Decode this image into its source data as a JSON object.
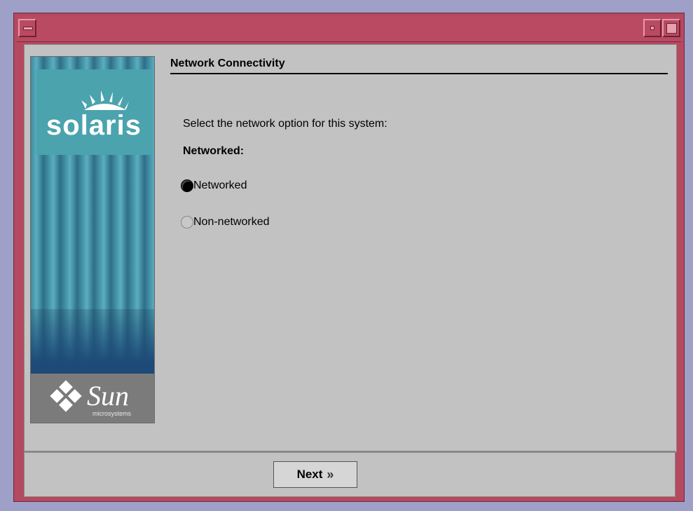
{
  "window": {
    "title": ""
  },
  "banner": {
    "product": "solaris",
    "vendor": "Sun",
    "vendor_sub": "microsystems"
  },
  "page": {
    "heading": "Network Connectivity",
    "prompt": "Select the network option for this system:",
    "group_label": "Networked:",
    "options": [
      {
        "label": "Networked",
        "selected": true
      },
      {
        "label": "Non-networked",
        "selected": false
      }
    ]
  },
  "footer": {
    "next_label": "Next"
  },
  "icons": {
    "window_menu": "window-menu-icon",
    "minimize": "minimize-icon",
    "maximize": "maximize-icon",
    "next": "chevron-right-icon"
  },
  "colors": {
    "title_bar": "#b94a62",
    "background": "#c2c2c2",
    "desktop": "#9ea0c8"
  }
}
